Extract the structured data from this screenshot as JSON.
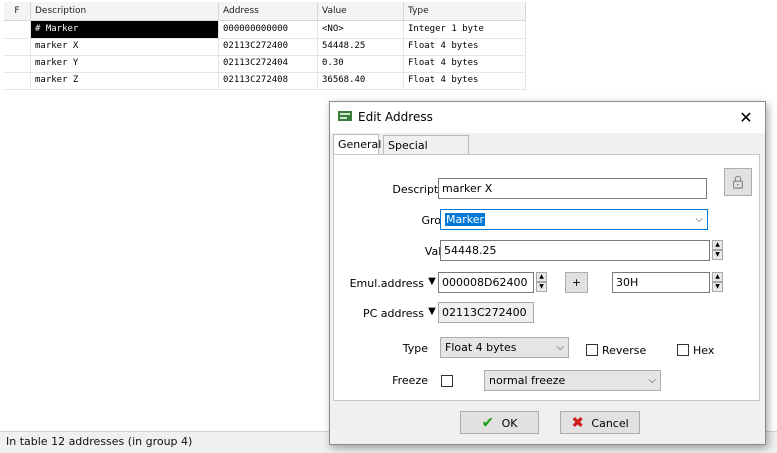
{
  "table": {
    "columns": [
      "F",
      "Description",
      "Address",
      "Value",
      "Type"
    ],
    "rows": [
      {
        "description": "# Marker",
        "address": "000000000000",
        "value": "<NO>",
        "type": "Integer 1 byte"
      },
      {
        "description": "marker X",
        "address": "02113C272400",
        "value": "54448.25",
        "type": "Float 4 bytes"
      },
      {
        "description": "marker Y",
        "address": "02113C272404",
        "value": "0.30",
        "type": "Float 4 bytes"
      },
      {
        "description": "marker Z",
        "address": "02113C272408",
        "value": "36568.40",
        "type": "Float 4 bytes"
      }
    ]
  },
  "statusbar": {
    "text": "In table 12 addresses (in group 4)"
  },
  "dialog": {
    "title": "Edit Address",
    "tabs": [
      "General",
      "Special Hotkeys"
    ],
    "description_label": "Description",
    "description_value": "marker X",
    "group_label": "Group",
    "group_value": "Marker",
    "value_label": "Value",
    "value_value": "54448.25",
    "emul_label": "Emul.address",
    "emul_value": "000008D62400",
    "plus_label": "+",
    "offset_value": "30H",
    "pc_label": "PC address",
    "pc_value": "02113C272400",
    "type_label": "Type",
    "type_value": "Float 4 bytes",
    "reverse_label": "Reverse",
    "hex_label": "Hex",
    "freeze_label": "Freeze",
    "freeze_mode": "normal freeze",
    "ok_label": "OK",
    "cancel_label": "Cancel"
  },
  "icons": {
    "lock": "lock-icon",
    "close": "close-icon",
    "ok": "checkmark-icon",
    "cancel": "x-icon"
  },
  "colors": {
    "selection": "#0078d7",
    "ok_check": "#1a9e1a",
    "cancel_x": "#d11a1a"
  }
}
